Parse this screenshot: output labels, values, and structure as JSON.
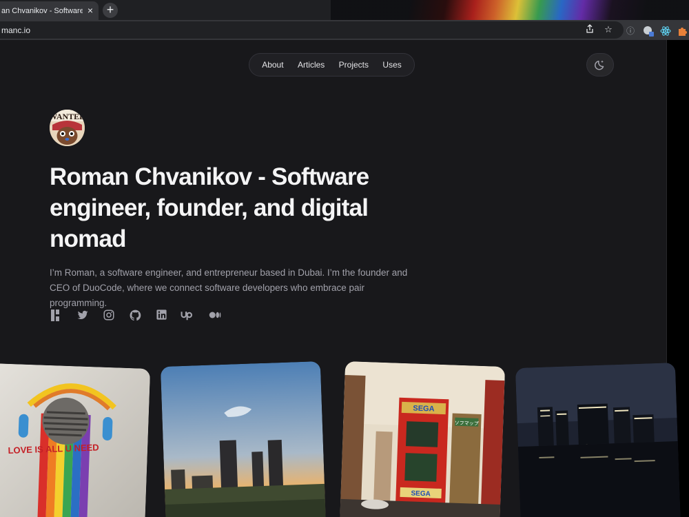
{
  "browser": {
    "tab_title": "an Chvanikov - Software e",
    "tab_close": "×",
    "new_tab": "+",
    "url": "manc.io"
  },
  "nav": {
    "items": [
      "About",
      "Articles",
      "Projects",
      "Uses"
    ]
  },
  "avatar_text": "WANTED",
  "hero": {
    "headline": "Roman Chvanikov - Software engineer, founder, and digital nomad",
    "bio": "I’m Roman, a software engineer, and entrepreneur based in Dubai. I’m the founder and CEO of DuoCode, where we connect software developers who embrace pair programming."
  },
  "socials": [
    "polywork-icon",
    "twitter-icon",
    "instagram-icon",
    "github-icon",
    "linkedin-icon",
    "upwork-icon",
    "medium-icon"
  ],
  "photos": [
    {
      "name": "photo-rainbow-graffiti",
      "wall_text": "LOVE IS ALL U NEED"
    },
    {
      "name": "photo-sunset-skyline"
    },
    {
      "name": "photo-sega-building",
      "signs": [
        "SEGA",
        "SEGA",
        "ソフマップ"
      ]
    },
    {
      "name": "photo-night-city"
    }
  ],
  "colors": {
    "background": "#18181b",
    "text_primary": "#f4f4f5",
    "text_secondary": "#a1a1aa"
  }
}
